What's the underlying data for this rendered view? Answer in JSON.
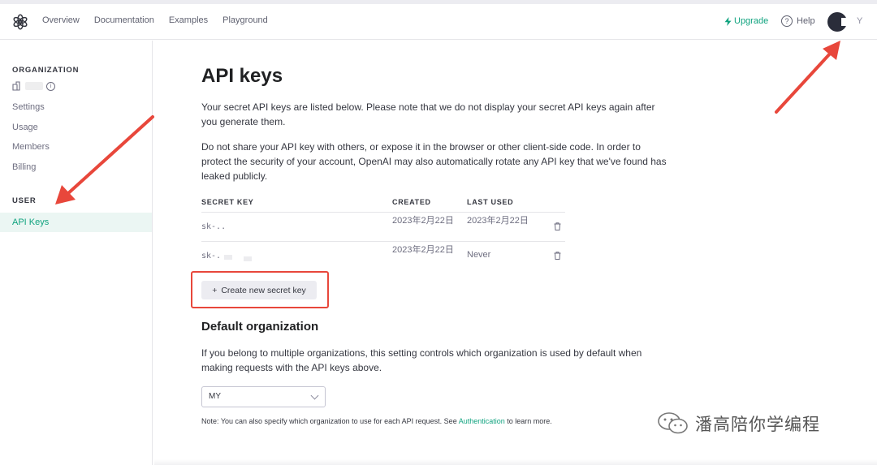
{
  "header": {
    "nav": [
      "Overview",
      "Documentation",
      "Examples",
      "Playground"
    ],
    "upgrade": "Upgrade",
    "help": "Help",
    "help_glyph": "?",
    "user_suffix": "Y"
  },
  "sidebar": {
    "organization_heading": "ORGANIZATION",
    "org_items": [
      "Settings",
      "Usage",
      "Members",
      "Billing"
    ],
    "user_heading": "USER",
    "active_item": "API Keys"
  },
  "main": {
    "title": "API keys",
    "intro": "Your secret API keys are listed below. Please note that we do not display your secret API keys again after you generate them.",
    "warning": "Do not share your API key with others, or expose it in the browser or other client-side code. In order to protect the security of your account, OpenAI may also automatically rotate any API key that we've found has leaked publicly.",
    "table": {
      "columns": [
        "SECRET KEY",
        "CREATED",
        "LAST USED"
      ],
      "rows": [
        {
          "key": "sk-..",
          "created": "2023年2月22日",
          "last_used": "2023年2月22日"
        },
        {
          "key": "sk-.",
          "created": "2023年2月22日",
          "last_used": "Never"
        }
      ]
    },
    "create_button": "Create new secret key",
    "create_icon": "+",
    "default_org_title": "Default organization",
    "default_org_text": "If you belong to multiple organizations, this setting controls which organization is used by default when making requests with the API keys above.",
    "org_select_value": "MY",
    "note_prefix": "Note: You can also specify which organization to use for each API request. See ",
    "note_link": "Authentication",
    "note_suffix": " to learn more."
  },
  "watermark": "潘高陪你学编程",
  "colors": {
    "brand": "#10a37f",
    "annotation": "#e8473b",
    "sidebar_active_bg": "#ebf6f3"
  }
}
